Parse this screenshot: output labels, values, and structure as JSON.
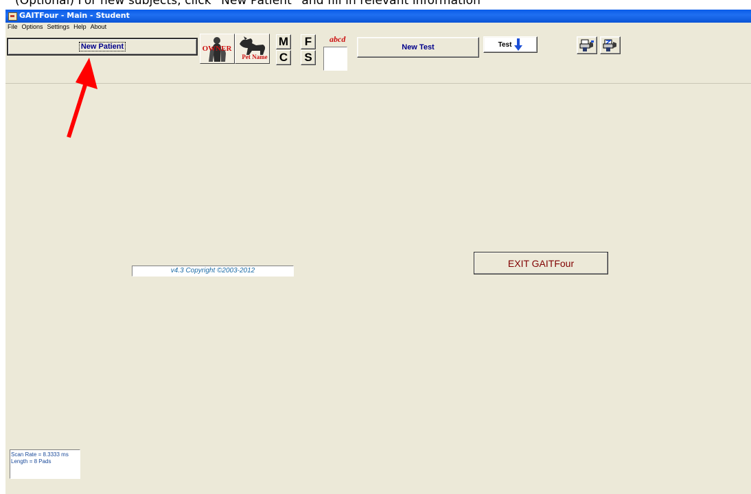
{
  "caption": {
    "text": "(Optional) For new subjects, click “New Patient” and fill in relevant information"
  },
  "window": {
    "title": "GAITFour - Main - Student"
  },
  "menu": {
    "items": [
      "File",
      "Options",
      "Settings",
      "Help",
      "About"
    ]
  },
  "toolbar": {
    "new_patient_label": "New Patient",
    "owner_label": "OWNER",
    "pet_name_label": "Pet Name",
    "letter_buttons": [
      "M",
      "F",
      "C",
      "S"
    ],
    "abcd_label": "abcd",
    "new_test_label": "New Test",
    "test_label": "Test"
  },
  "main": {
    "copyright": "v4.3 Copyright ©2003-2012",
    "exit_label": "EXIT GAITFour"
  },
  "status": {
    "scan_rate": "Scan Rate = 8.3333 ms",
    "length": "Length = 8 Pads"
  },
  "colors": {
    "annotation_arrow": "#ff0000",
    "titlebar": "#0a5ce8",
    "window_bg": "#ece9d8",
    "button_text": "#00008b"
  },
  "icons": {
    "owner": "owner-person-icon",
    "pet": "dog-icon",
    "test_arrow": "arrow-down-icon",
    "tool1": "print-icon",
    "tool2": "export-icon"
  }
}
